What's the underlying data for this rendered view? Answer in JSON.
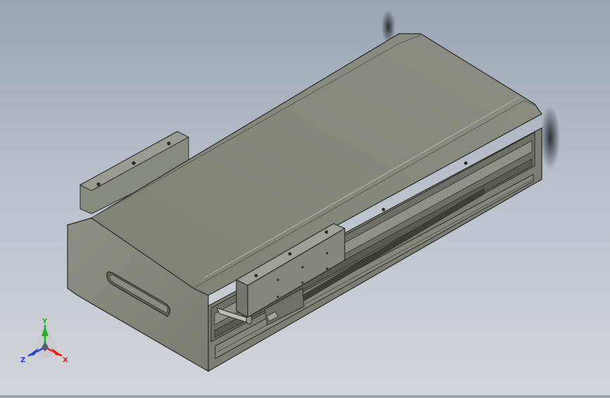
{
  "viewport": {
    "background_top": "#9aa4b3",
    "background_bottom": "#d3d6da",
    "model_body_color": "#85877c",
    "model_edge_color": "#2b2b27"
  },
  "triad": {
    "x_label": "X",
    "y_label": "Y",
    "z_label": "Z",
    "x_color": "#e02020",
    "y_color": "#22b022",
    "z_color": "#2040e0"
  }
}
